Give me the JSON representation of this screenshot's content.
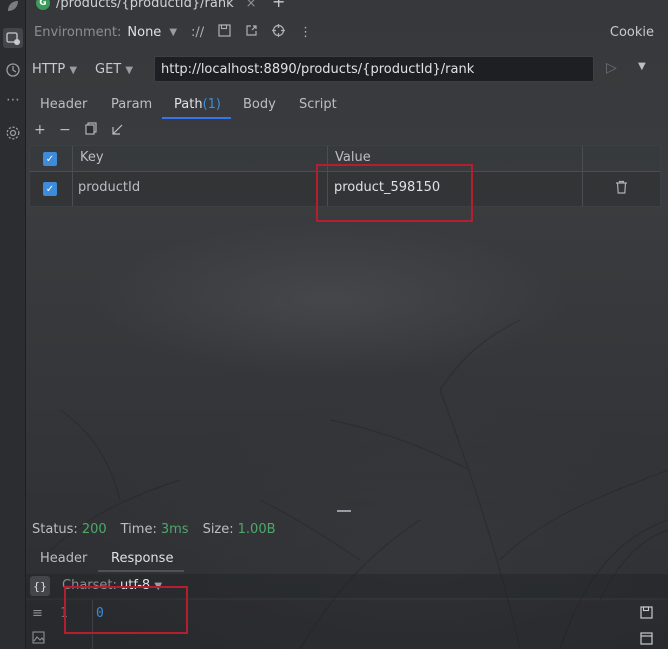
{
  "tab": {
    "badge": "G",
    "title": "/products/{productId}/rank",
    "close": "×",
    "add": "+"
  },
  "env": {
    "label": "Environment:",
    "value": "None",
    "cookie": "Cookie"
  },
  "request": {
    "protocol": "HTTP",
    "method": "GET",
    "url": "http://localhost:8890/products/{productId}/rank"
  },
  "subtabs": [
    {
      "label": "Header"
    },
    {
      "label": "Param"
    },
    {
      "label": "Path",
      "count": "(1)"
    },
    {
      "label": "Body"
    },
    {
      "label": "Script"
    }
  ],
  "table": {
    "headers": {
      "key": "Key",
      "value": "Value"
    },
    "rows": [
      {
        "key": "productId",
        "value": "product_598150"
      }
    ]
  },
  "status": {
    "status_label": "Status:",
    "status_value": "200",
    "time_label": "Time:",
    "time_value": "3ms",
    "size_label": "Size:",
    "size_value": "1.00B"
  },
  "response_tabs": [
    {
      "label": "Header"
    },
    {
      "label": "Response"
    }
  ],
  "response": {
    "format_icon": "{}",
    "charset_label": "Charset:",
    "charset_value": "utf-8",
    "line_number": "1",
    "body": "0"
  },
  "colors": {
    "accent": "#3574f0",
    "success": "#4ea86a",
    "highlight": "#b51e2e"
  }
}
